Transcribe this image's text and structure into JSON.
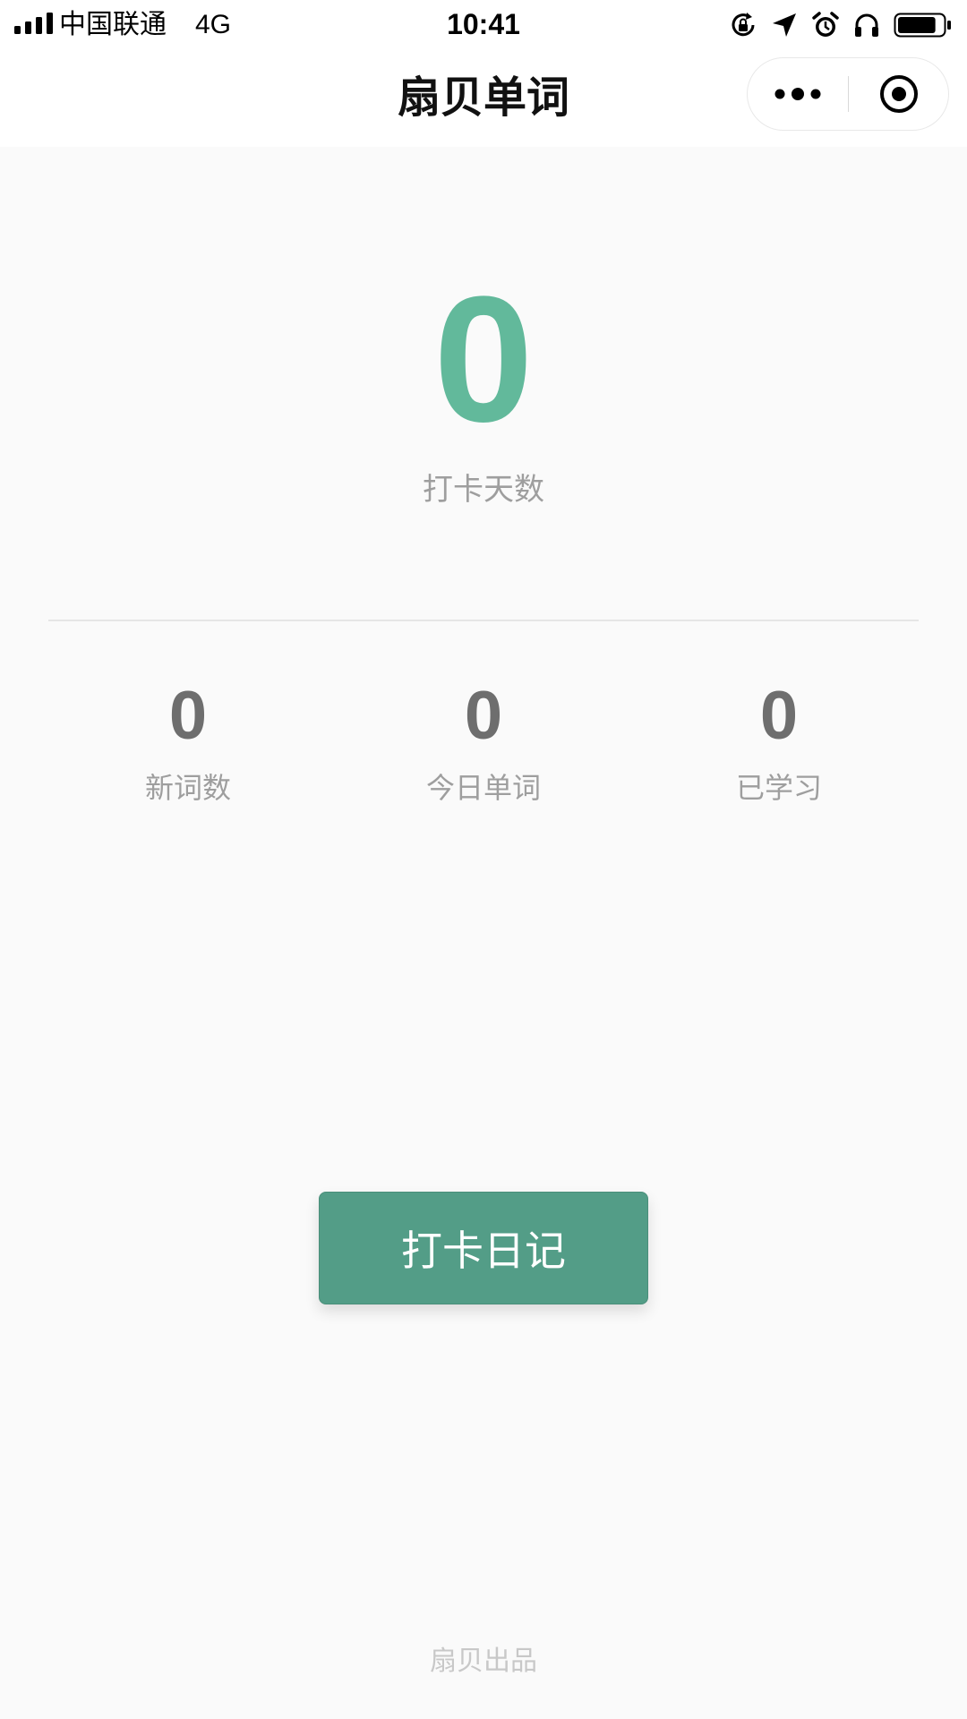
{
  "status_bar": {
    "carrier": "中国联通",
    "network": "4G",
    "time": "10:41",
    "icons": [
      "signal-icon",
      "rotation-lock-icon",
      "location-icon",
      "alarm-icon",
      "headphones-icon",
      "battery-icon"
    ],
    "battery_level": 0.85
  },
  "nav": {
    "title": "扇贝单词",
    "more_icon": "more-dots-icon",
    "close_icon": "target-close-icon"
  },
  "main": {
    "checkin_days": {
      "value": "0",
      "label": "打卡天数"
    },
    "stats": [
      {
        "value": "0",
        "label": "新词数"
      },
      {
        "value": "0",
        "label": "今日单词"
      },
      {
        "value": "0",
        "label": "已学习"
      }
    ],
    "diary_button_label": "打卡日记"
  },
  "footer": {
    "text": "扇贝出品"
  },
  "colors": {
    "accent": "#62b99b",
    "button": "#539d87",
    "background": "#fafafa",
    "muted_text": "#9e9e9e"
  }
}
